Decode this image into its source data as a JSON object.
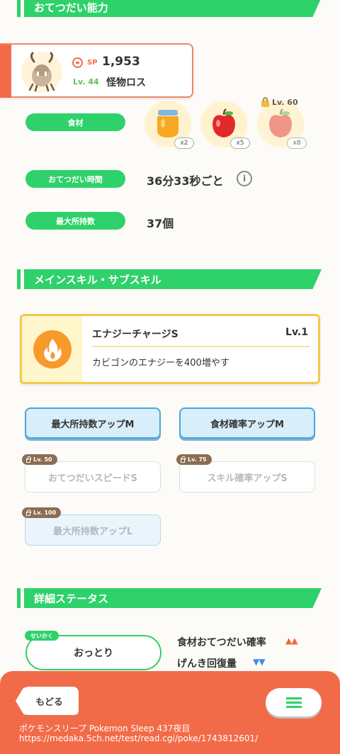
{
  "sections": {
    "helping": "おてつだい能力",
    "skills": "メインスキル・サブスキル",
    "status": "詳細ステータス"
  },
  "pokemon": {
    "sp_label": "SP",
    "sp_value": "1,953",
    "level": "Lv. 44",
    "name": "怪物ロス"
  },
  "helping": {
    "ingredients_label": "食材",
    "ingredients": [
      {
        "name": "honey",
        "count": "x2",
        "locked": false
      },
      {
        "name": "apple",
        "count": "x5",
        "locked": false
      },
      {
        "name": "apple",
        "count": "x8",
        "locked": true,
        "lock_level": "Lv. 60"
      }
    ],
    "time_label": "おてつだい時間",
    "time_value": "36分33秒ごと",
    "info_icon": "i",
    "carry_label": "最大所持数",
    "carry_value": "37個"
  },
  "main_skill": {
    "name": "エナジーチャージS",
    "level": "Lv.1",
    "description": "カビゴンのエナジーを400増やす"
  },
  "sub_skills": [
    {
      "label": "最大所持数アップM",
      "unlocked": true
    },
    {
      "label": "食材確率アップM",
      "unlocked": true
    },
    {
      "label": "おてつだいスピードS",
      "unlocked": false,
      "lock_level": "Lv. 50"
    },
    {
      "label": "スキル確率アップS",
      "unlocked": false,
      "lock_level": "Lv. 75"
    },
    {
      "label": "最大所持数アップL",
      "unlocked": false,
      "lock_level": "Lv. 100"
    }
  ],
  "nature": {
    "tag": "せいかく",
    "value": "おっとり",
    "up_stat": "食材おてつだい確率",
    "up_marks": "▲▲",
    "down_stat": "げんき回復量",
    "down_marks": "▼▼",
    "up_color": "#f2663a",
    "down_color": "#3a8ee6"
  },
  "footer": {
    "back_label": "もどる",
    "caption_line1": "ポケモンスリープ Pokemon Sleep 437夜目",
    "caption_line2": "https://medaka.5ch.net/test/read.cgi/poke/1743812601/"
  }
}
